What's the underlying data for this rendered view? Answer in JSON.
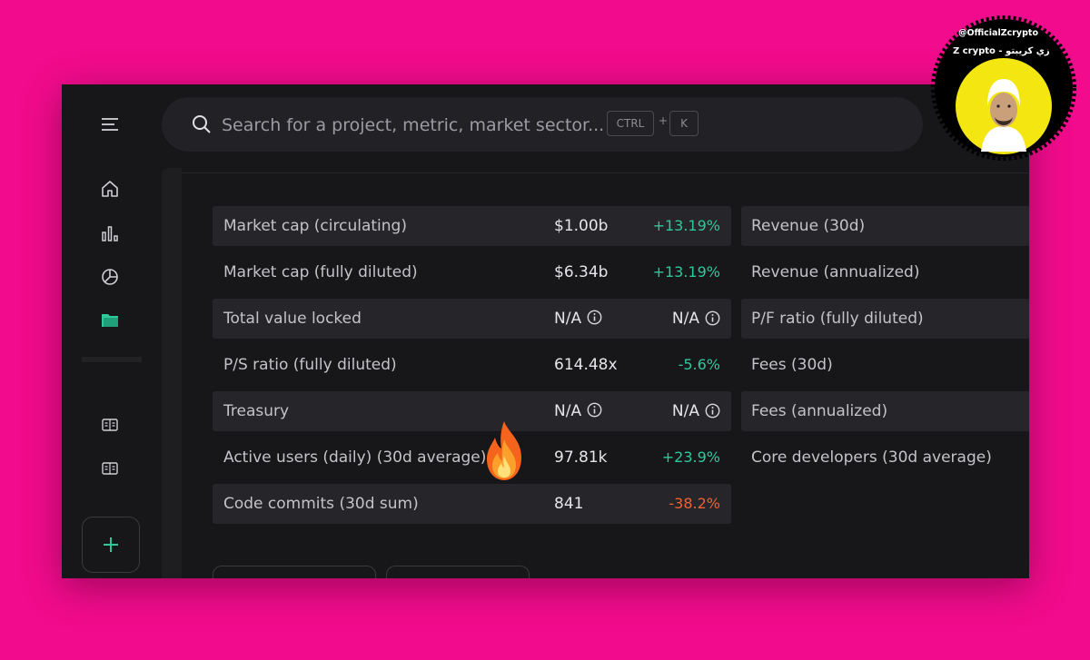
{
  "search": {
    "placeholder": "Search for a project, metric, market sector...",
    "shortcut_key1": "CTRL",
    "shortcut_plus": "+",
    "shortcut_key2": "K"
  },
  "sidebar": {
    "items": [
      {
        "name": "menu",
        "icon": "hamburger-menu-icon"
      },
      {
        "name": "home",
        "icon": "home-icon"
      },
      {
        "name": "charts",
        "icon": "bar-chart-icon"
      },
      {
        "name": "dashboards",
        "icon": "pie-chart-icon"
      },
      {
        "name": "projects",
        "icon": "folder-icon",
        "active": true
      },
      {
        "name": "docs-1",
        "icon": "book-icon"
      },
      {
        "name": "docs-2",
        "icon": "book-icon"
      },
      {
        "name": "add",
        "icon": "plus-icon"
      }
    ]
  },
  "metrics_left": [
    {
      "label": "Market cap (circulating)",
      "value": "$1.00b",
      "change": "+13.19%",
      "dir": "pos"
    },
    {
      "label": "Market cap (fully diluted)",
      "value": "$6.34b",
      "change": "+13.19%",
      "dir": "pos"
    },
    {
      "label": "Total value locked",
      "value": "N/A",
      "change": "N/A",
      "dir": "na"
    },
    {
      "label": "P/S ratio (fully diluted)",
      "value": "614.48x",
      "change": "-5.6%",
      "dir": "pos"
    },
    {
      "label": "Treasury",
      "value": "N/A",
      "change": "N/A",
      "dir": "na"
    },
    {
      "label": "Active users (daily) (30d average)",
      "value": "97.81k",
      "change": "+23.9%",
      "dir": "pos"
    },
    {
      "label": "Code commits (30d sum)",
      "value": "841",
      "change": "-38.2%",
      "dir": "neg"
    }
  ],
  "metrics_right": [
    {
      "label": "Revenue (30d)"
    },
    {
      "label": "Revenue (annualized)"
    },
    {
      "label": "P/F ratio (fully diluted)"
    },
    {
      "label": "Fees (30d)"
    },
    {
      "label": "Fees (annualized)"
    },
    {
      "label": "Core developers (30d average)"
    }
  ],
  "badge": {
    "handle": "@OfficialZcrypto",
    "name": "Z crypto - زي كريبتو"
  },
  "colors": {
    "background": "#f20b8c",
    "panel": "#17171a",
    "row_shade": "#26262a",
    "positive": "#2ec99a",
    "negative": "#ef6231",
    "accent": "#2ec99a"
  }
}
